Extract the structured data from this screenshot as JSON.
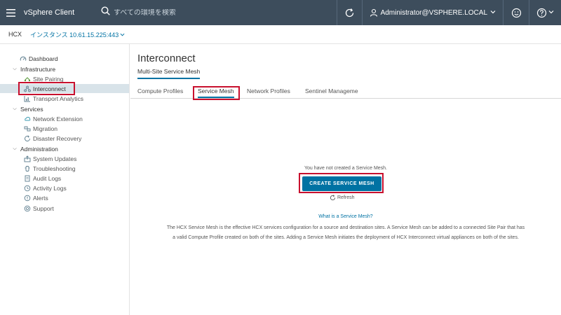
{
  "header": {
    "app_title": "vSphere Client",
    "search_placeholder": "すべての環境を検索",
    "user": "Administrator@VSPHERE.LOCAL"
  },
  "subheader": {
    "product": "HCX",
    "instance": "インスタンス 10.61.15.225:443"
  },
  "sidebar": {
    "dashboard": "Dashboard",
    "infrastructure": "Infrastructure",
    "site_pairing": "Site Pairing",
    "interconnect": "Interconnect",
    "transport_analytics": "Transport Analytics",
    "services": "Services",
    "network_extension": "Network Extension",
    "migration": "Migration",
    "disaster_recovery": "Disaster Recovery",
    "administration": "Administration",
    "system_updates": "System Updates",
    "troubleshooting": "Troubleshooting",
    "audit_logs": "Audit Logs",
    "activity_logs": "Activity Logs",
    "alerts": "Alerts",
    "support": "Support"
  },
  "main": {
    "title": "Interconnect",
    "subnav": "Multi-Site Service Mesh",
    "tabs": [
      "Compute Profiles",
      "Service Mesh",
      "Network Profiles",
      "Sentinel Manageme"
    ],
    "empty_message": "You have not created a Service Mesh.",
    "create_button": "CREATE SERVICE MESH",
    "refresh": "Refresh",
    "help_link": "What is a Service Mesh?",
    "description": "The HCX Service Mesh is the effective HCX services configuration for a source and destination sites. A Service Mesh can be added to a connected Site Pair that has a valid Compute Profile created on both of the sites. Adding a Service Mesh initiates the deployment of HCX Interconnect virtual appliances on both of the sites."
  },
  "colors": {
    "header_bg": "#3d4d5c",
    "accent": "#0072a3",
    "highlight": "#c8102e",
    "active_nav_bg": "#d8e3e9"
  }
}
